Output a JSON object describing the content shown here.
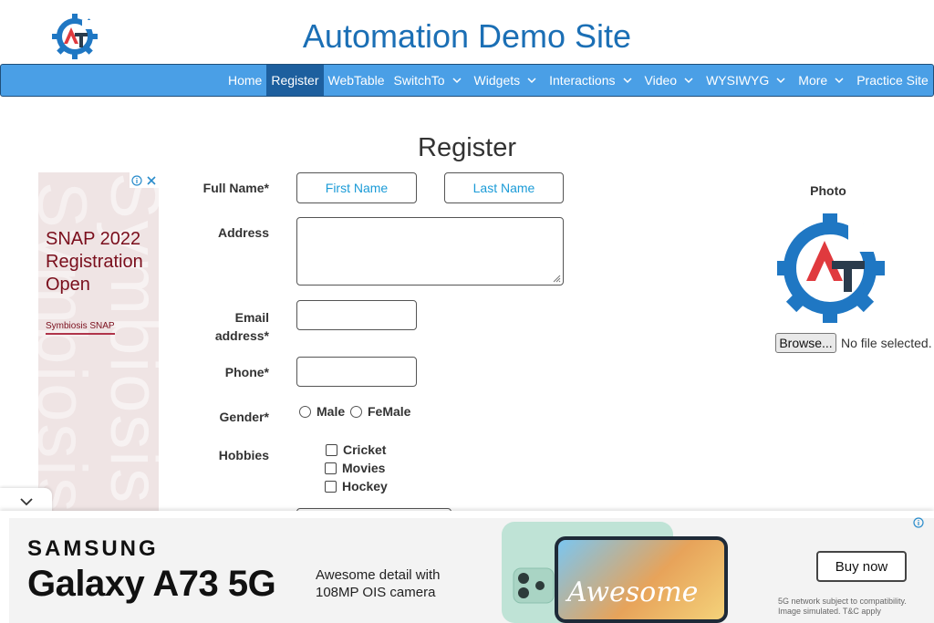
{
  "site": {
    "title": "Automation Demo Site"
  },
  "nav": {
    "items": [
      {
        "label": "Home",
        "dropdown": false,
        "active": false
      },
      {
        "label": "Register",
        "dropdown": false,
        "active": true
      },
      {
        "label": "WebTable",
        "dropdown": false,
        "active": false
      },
      {
        "label": "SwitchTo",
        "dropdown": true,
        "active": false
      },
      {
        "label": "Widgets",
        "dropdown": true,
        "active": false
      },
      {
        "label": "Interactions",
        "dropdown": true,
        "active": false
      },
      {
        "label": "Video",
        "dropdown": true,
        "active": false
      },
      {
        "label": "WYSIWYG",
        "dropdown": true,
        "active": false
      },
      {
        "label": "More",
        "dropdown": true,
        "active": false
      },
      {
        "label": "Practice Site",
        "dropdown": false,
        "active": false
      }
    ]
  },
  "page": {
    "heading": "Register"
  },
  "form": {
    "full_name_label": "Full Name*",
    "first_name_placeholder": "First Name",
    "last_name_placeholder": "Last Name",
    "address_label": "Address",
    "email_label_line1": "Email",
    "email_label_line2": "address*",
    "phone_label": "Phone*",
    "gender_label": "Gender*",
    "gender_options": [
      "Male",
      "FeMale"
    ],
    "hobbies_label": "Hobbies",
    "hobbies": [
      "Cricket",
      "Movies",
      "Hockey"
    ]
  },
  "photo": {
    "label": "Photo",
    "browse_label": "Browse...",
    "status": "No file selected."
  },
  "left_ad": {
    "headline": "SNAP 2022 Registration Open",
    "brand": "Symbiosis SNAP",
    "watermark": "Symbiosis"
  },
  "bottom_ad": {
    "brand": "SAMSUNG",
    "product": "Galaxy A73 5G",
    "feature_line1": "Awesome detail with",
    "feature_line2": "108MP OIS camera",
    "screen_text": "Awesome",
    "cta": "Buy now",
    "disclaimer_line1": "5G network subject to compatibility.",
    "disclaimer_line2": "Image simulated. T&C apply"
  },
  "colors": {
    "title": "#1b6fb5",
    "navbar": "#4a9fe6",
    "nav_active": "#1d5f9e",
    "logo_blue": "#1f77c3",
    "logo_red": "#e03a3e"
  },
  "icons": [
    "logo-gear-icon",
    "chevron-down-icon",
    "ad-info-icon",
    "ad-close-icon",
    "collapse-chevron-icon"
  ]
}
